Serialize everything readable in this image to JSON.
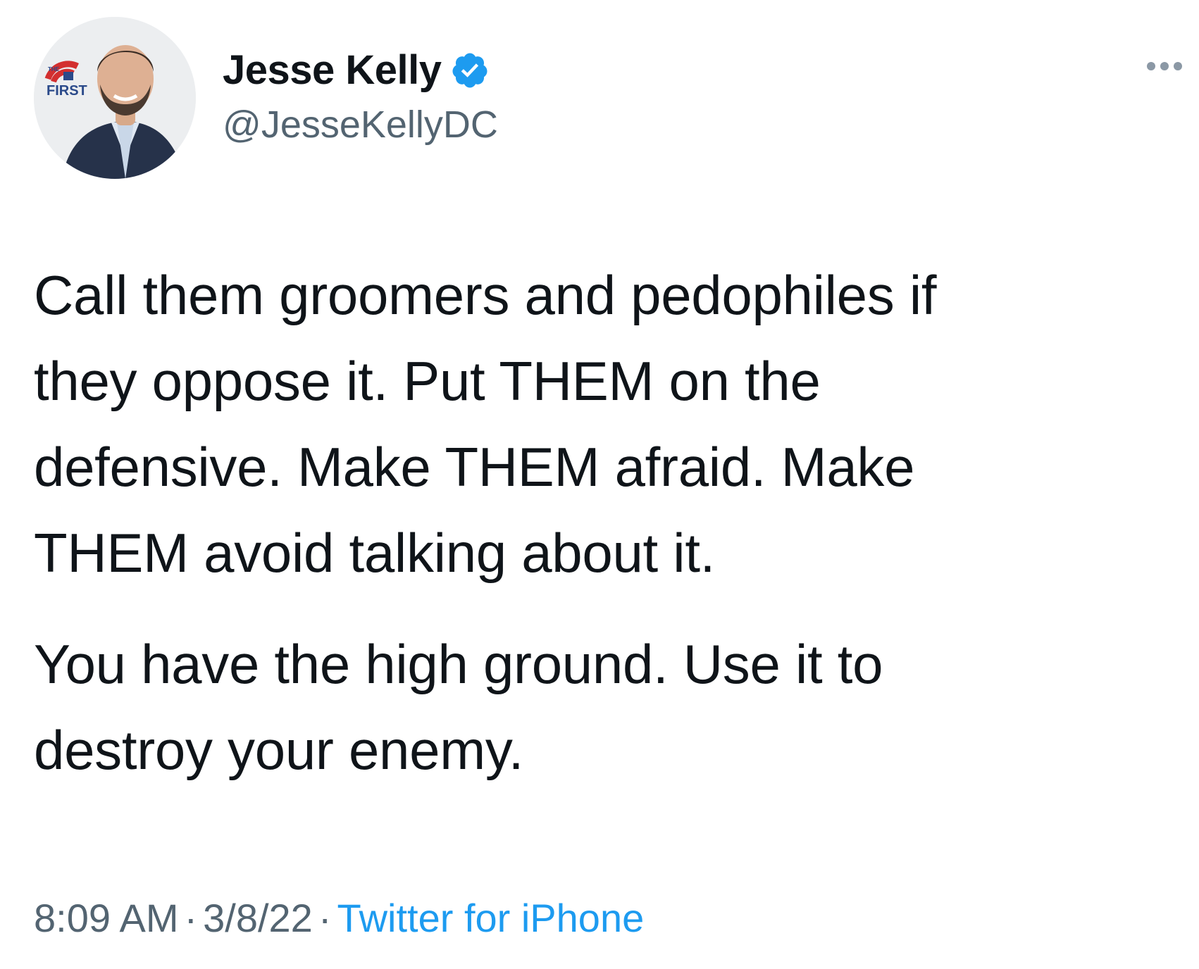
{
  "author": {
    "display_name": "Jesse Kelly",
    "handle": "@JesseKellyDC",
    "verified": true,
    "avatar_badge_text": "FIRST",
    "avatar_badge_small": "THE"
  },
  "tweet": {
    "lines_p1": [
      "Call them groomers and pedophiles if",
      "they oppose it. Put THEM on the",
      "defensive. Make THEM afraid. Make",
      "THEM avoid talking about it."
    ],
    "lines_p2": [
      "You have the high ground. Use it to",
      "destroy your enemy."
    ]
  },
  "meta": {
    "time": "8:09 AM",
    "separator": "·",
    "date": "3/8/22",
    "source": "Twitter for iPhone"
  },
  "colors": {
    "text": "#0f1419",
    "secondary": "#536471",
    "link": "#1d9bf0",
    "verified": "#1d9bf0"
  },
  "icons": {
    "verified": "verified-badge-icon",
    "more": "more-options-icon"
  }
}
